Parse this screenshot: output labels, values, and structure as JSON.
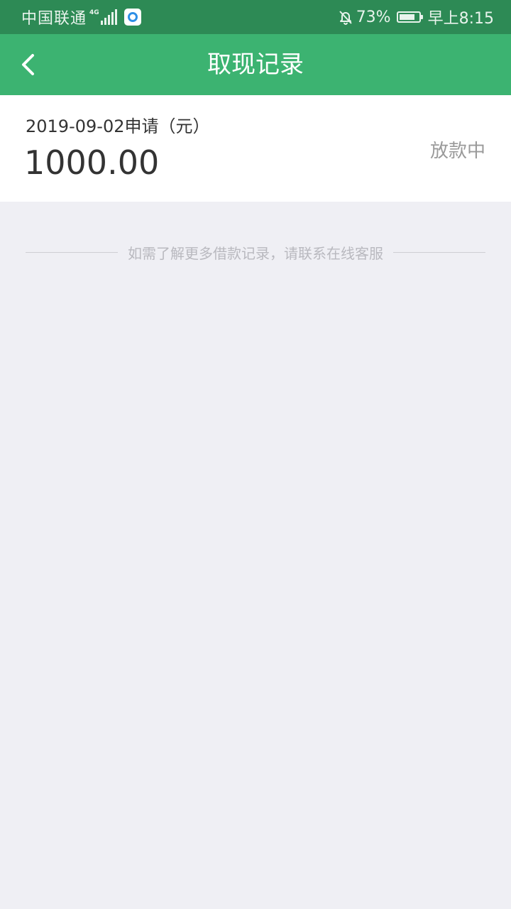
{
  "status_bar": {
    "carrier": "中国联通",
    "network": "4G",
    "battery_percent": "73%",
    "battery_level": 0.73,
    "time": "早上8:15",
    "icons": [
      "signal-icon",
      "app-notification-icon",
      "mute-bell-icon",
      "battery-icon"
    ]
  },
  "nav": {
    "title": "取现记录",
    "back_icon": "chevron-left-icon"
  },
  "records": [
    {
      "date_label": "2019-09-02申请（元）",
      "amount": "1000.00",
      "status": "放款中"
    }
  ],
  "footer": {
    "note": "如需了解更多借款记录，请联系在线客服"
  },
  "colors": {
    "status_bar": "#2d8a55",
    "nav_bar": "#3cb371",
    "page_background": "#efeff4"
  }
}
